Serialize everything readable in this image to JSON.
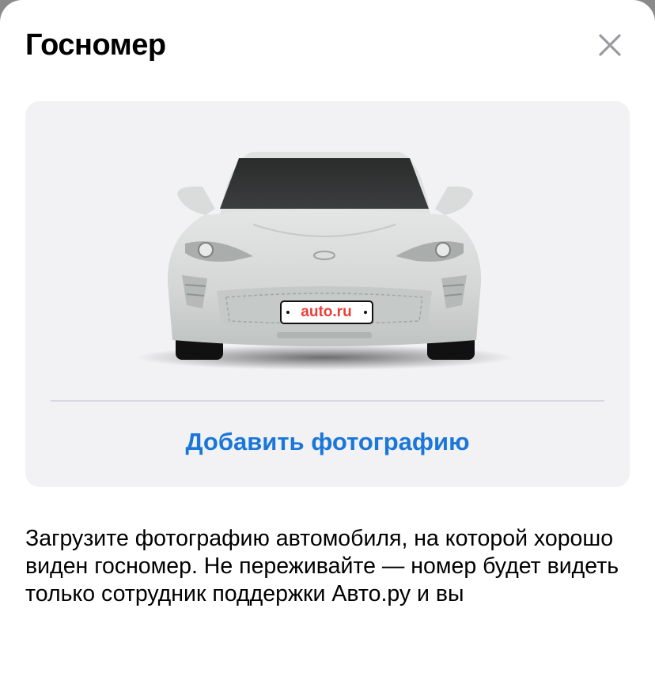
{
  "dialog": {
    "title": "Госномер",
    "close_icon": "close-icon"
  },
  "photo_card": {
    "plate_text": "auto.ru",
    "add_photo_label": "Добавить фотографию",
    "car_icon": "car-front-illustration"
  },
  "description": {
    "text": "Загрузите фотографию автомобиля, на которой хорошо виден госномер. Не переживайте — номер будет видеть только сотрудник поддержки Авто.ру и вы"
  },
  "colors": {
    "accent": "#1a77d9",
    "card_bg": "#f2f2f5",
    "plate_text": "#e8413a"
  }
}
